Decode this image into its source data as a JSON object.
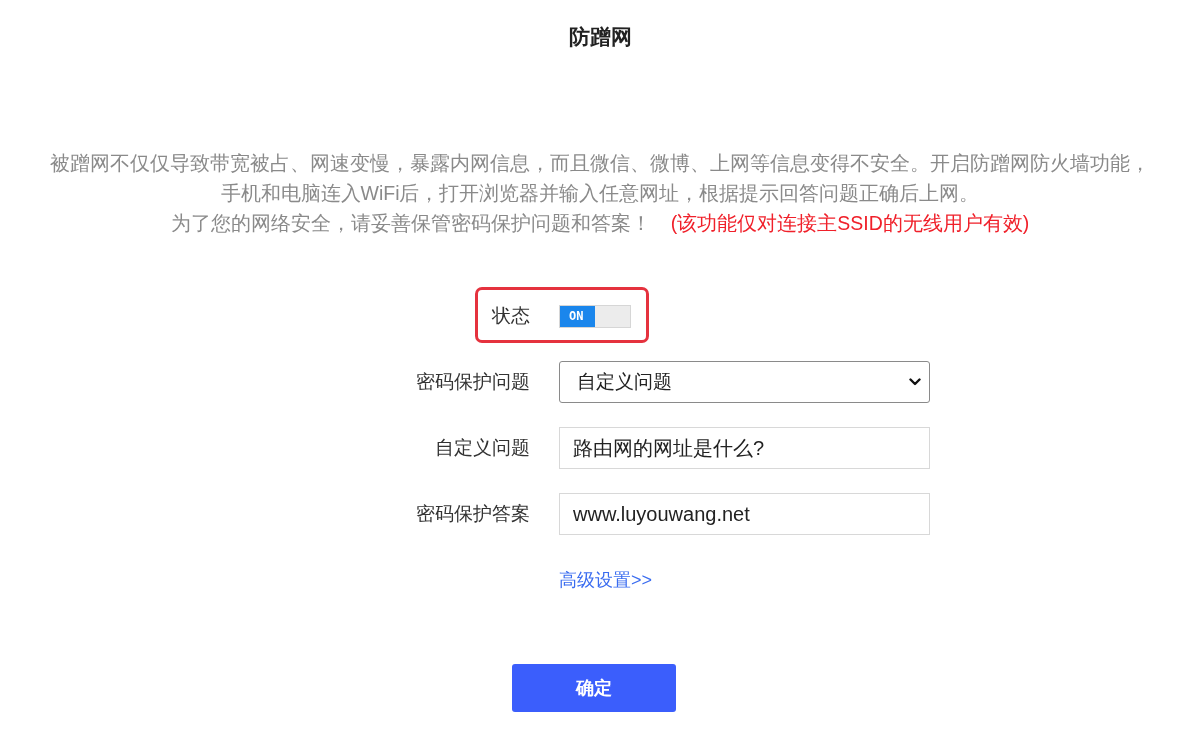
{
  "title": "防蹭网",
  "description": {
    "lines": [
      "被蹭网不仅仅导致带宽被占、网速变慢，暴露内网信息，而且微信、微博、上网等信息变得不安全。开启防蹭网防火墙功能，",
      "手机和电脑连入WiFi后，打开浏览器并输入任意网址，根据提示回答问题正确后上网。",
      "为了您的网络安全，请妥善保管密码保护问题和答案！"
    ],
    "note": "(该功能仅对连接主SSID的无线用户有效)"
  },
  "form": {
    "status": {
      "label": "状态",
      "on": true,
      "toggle_text": "ON",
      "highlighted": true
    },
    "fields": [
      {
        "kind": "select",
        "label": "密码保护问题",
        "value": "自定义问题"
      },
      {
        "kind": "text",
        "label": "自定义问题",
        "value": "路由网的网址是什么?"
      },
      {
        "kind": "text",
        "label": "密码保护答案",
        "value": "www.luyouwang.net"
      }
    ],
    "advanced_link": "高级设置>>"
  },
  "confirm_button": "确定"
}
